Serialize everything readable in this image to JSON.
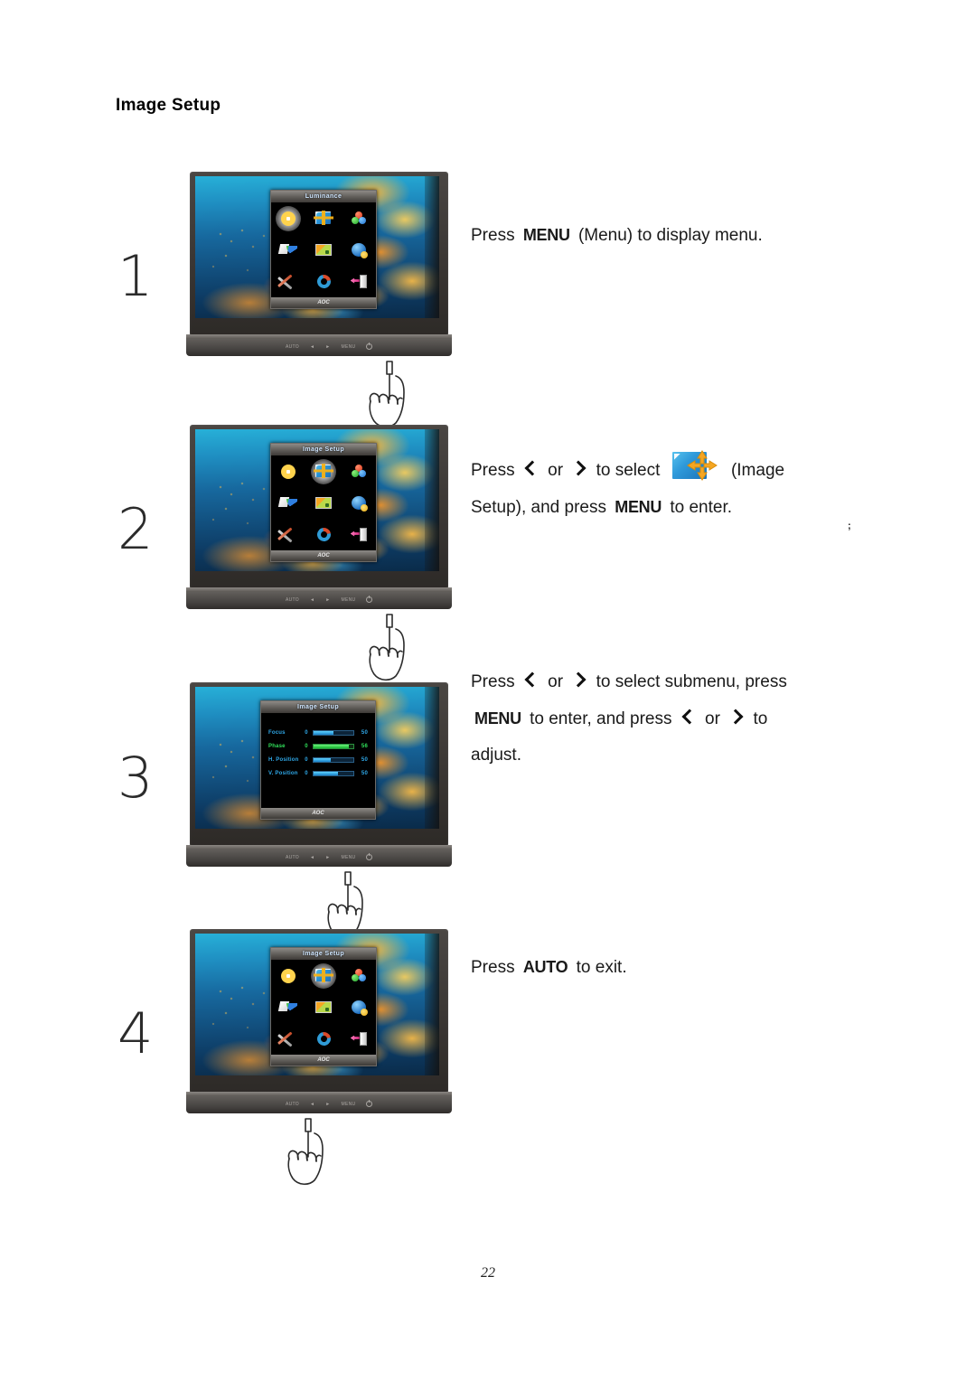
{
  "page": {
    "title": "Image Setup",
    "number": "22",
    "stray_artifact": ";"
  },
  "osd": {
    "menu_title_luminance": "Luminance",
    "menu_title_image_setup": "Image Setup",
    "brand": "AOC",
    "icons": [
      {
        "name": "luminance-icon",
        "label": "Luminance"
      },
      {
        "name": "image-setup-icon",
        "label": "Image Setup"
      },
      {
        "name": "color-setup-icon",
        "label": "Color Setup"
      },
      {
        "name": "picture-boost-icon",
        "label": "Picture Boost"
      },
      {
        "name": "osd-setup-icon",
        "label": "OSD Setup"
      },
      {
        "name": "extra-icon",
        "label": "Extra"
      },
      {
        "name": "reset-icon",
        "label": "Reset"
      },
      {
        "name": "recall-icon",
        "label": "Recall"
      },
      {
        "name": "exit-icon",
        "label": "Exit"
      }
    ],
    "submenu": {
      "title": "Image Setup",
      "rows": [
        {
          "label": "Focus",
          "min": "0",
          "value": "50",
          "percent": 50,
          "active": false
        },
        {
          "label": "Phase",
          "min": "0",
          "value": "56",
          "percent": 88,
          "active": true
        },
        {
          "label": "H. Position",
          "min": "0",
          "value": "50",
          "percent": 44,
          "active": false
        },
        {
          "label": "V. Position",
          "min": "0",
          "value": "50",
          "percent": 62,
          "active": false
        }
      ]
    }
  },
  "bezel": {
    "buttons": [
      "AUTO",
      "◄",
      "►",
      "MENU"
    ],
    "power_label": "power"
  },
  "steps": [
    {
      "number": "1",
      "osd_title": "Luminance",
      "selected_icon": 0,
      "pointed_button": "MENU",
      "text": {
        "l1_a": "Press",
        "l1_key": "MENU",
        "l1_b": "(Menu) to display menu."
      }
    },
    {
      "number": "2",
      "osd_title": "Image Setup",
      "selected_icon": 1,
      "pointed_button": "►",
      "text": {
        "l1_a": "Press",
        "l1_or": "or",
        "l1_b": "to select",
        "l1_c": "(Image",
        "l2_a": "Setup), and press",
        "l2_key": "MENU",
        "l2_b": "to enter."
      }
    },
    {
      "number": "3",
      "osd_title": "Image Setup",
      "pointed_button": "►",
      "text": {
        "l1_a": "Press",
        "l1_or": "or",
        "l1_b": "to select submenu, press",
        "l2_key": "MENU",
        "l2_a": "to enter, and press",
        "l2_or": "or",
        "l2_b": "to",
        "l3": "adjust."
      }
    },
    {
      "number": "4",
      "osd_title": "Image Setup",
      "selected_icon": 1,
      "pointed_button": "AUTO",
      "text": {
        "l1_a": "Press",
        "l1_key": "AUTO",
        "l1_b": "to exit."
      }
    }
  ],
  "colors": {
    "accent_blue": "#2f9ada",
    "highlight_green": "#31e05a",
    "bezel_gray": "#565350",
    "osd_black": "#050505"
  }
}
